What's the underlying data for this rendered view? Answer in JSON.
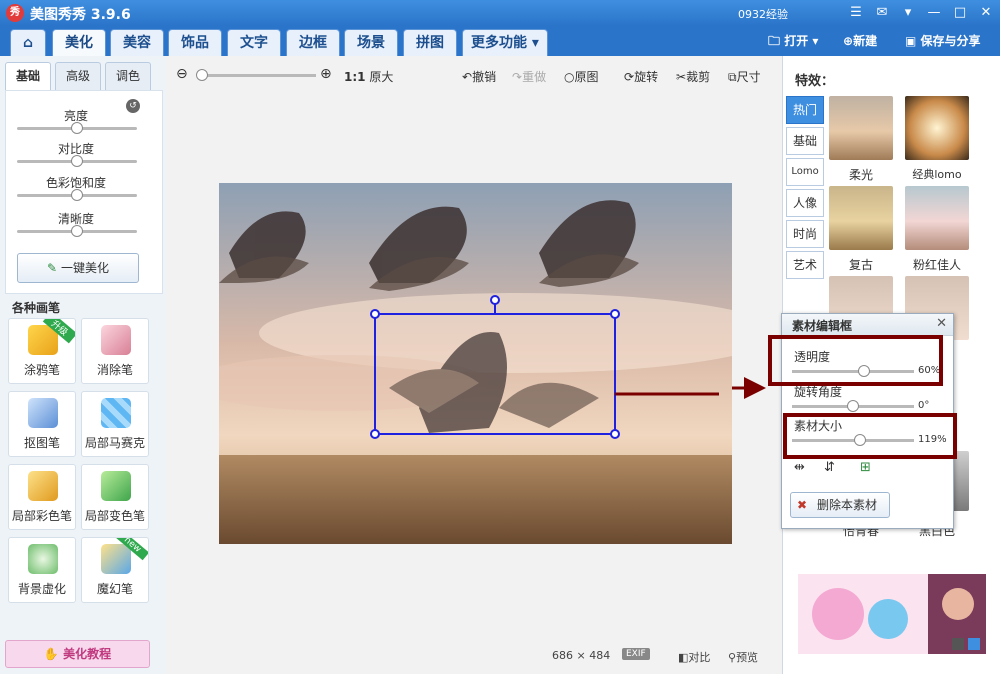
{
  "app": {
    "title": "美图秀秀 3.9.6",
    "logo": "秀",
    "user": "0932经验"
  },
  "window_icons": [
    "menu-icon",
    "skin-icon",
    "help-icon",
    "minimize-icon",
    "maximize-icon",
    "close-icon"
  ],
  "nav": {
    "tabs": [
      "美化",
      "美容",
      "饰品",
      "文字",
      "边框",
      "场景",
      "拼图",
      "更多功能"
    ],
    "open": "打开",
    "new": "新建",
    "save": "保存与分享"
  },
  "left_panel": {
    "subtabs": [
      "基础",
      "高级",
      "调色"
    ],
    "sliders": [
      {
        "label": "亮度",
        "level": 0.5
      },
      {
        "label": "对比度",
        "level": 0.5
      },
      {
        "label": "色彩饱和度",
        "level": 0.5
      },
      {
        "label": "清晰度",
        "level": 0.5
      }
    ],
    "one_key": "一键美化",
    "section_title": "各种画笔",
    "tools": [
      {
        "label": "涂鸦笔",
        "badge": "升级"
      },
      {
        "label": "消除笔"
      },
      {
        "label": "抠图笔"
      },
      {
        "label": "局部马赛克"
      },
      {
        "label": "局部彩色笔"
      },
      {
        "label": "局部变色笔"
      },
      {
        "label": "背景虚化"
      },
      {
        "label": "魔幻笔",
        "badge": "new"
      }
    ],
    "tutorial": "美化教程"
  },
  "toolbar": {
    "zoom_ratio": "1:1",
    "original_size": "原大",
    "undo": "撤销",
    "redo": "重做",
    "original": "原图",
    "rotate": "旋转",
    "crop": "裁剪",
    "resize": "尺寸"
  },
  "status": {
    "dimensions": "686 × 484",
    "exif": "EXIF",
    "compare": "对比",
    "preview": "预览"
  },
  "effects": {
    "title": "特效：",
    "tabs": [
      "热门",
      "基础",
      "Lomo",
      "人像",
      "时尚",
      "艺术"
    ],
    "thumbs": [
      "柔光",
      "经典lomo",
      "复古",
      "粉红佳人",
      "",
      ""
    ],
    "bottom_labels": [
      "怡青春",
      "黑白色"
    ]
  },
  "dialog": {
    "title": "素材编辑框",
    "opacity_label": "透明度",
    "opacity_value": "60%",
    "opacity_level": 0.6,
    "rotation_label": "旋转角度",
    "rotation_value": "0°",
    "rotation_level": 0.5,
    "size_label": "素材大小",
    "size_value": "119%",
    "size_level": 0.56,
    "delete": "删除本素材"
  },
  "colors": {
    "accent": "#2a74c9",
    "highlight": "#7a0000",
    "selection": "#1e22e0"
  }
}
